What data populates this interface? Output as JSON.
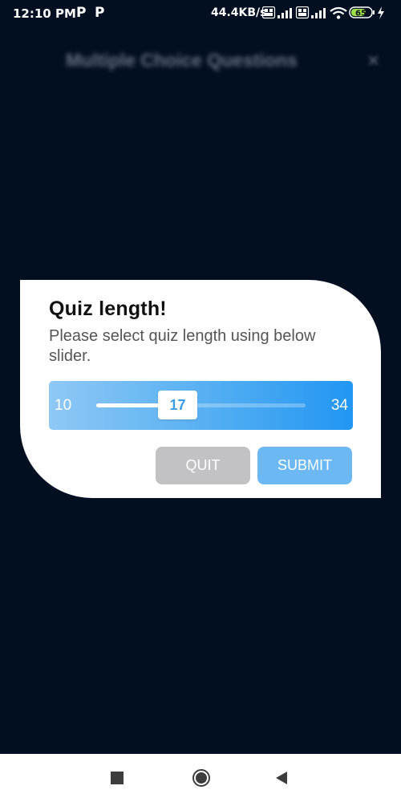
{
  "status_bar": {
    "time": "12:10 PM",
    "notif_1": "P",
    "notif_2": "P",
    "net_speed": "44.4KB/s",
    "volte_1": "Vo LTE",
    "volte_2": "Vo LTE",
    "battery": "65",
    "icons": [
      "signal-icon",
      "signal-icon",
      "wifi-icon",
      "battery-icon",
      "charging-icon"
    ]
  },
  "background": {
    "title": "Multiple Choice Questions",
    "close": "×"
  },
  "dialog": {
    "title": "Quiz length!",
    "message": "Please select quiz length using below slider.",
    "slider": {
      "min": "10",
      "max": "34",
      "value": "17",
      "min_value": 10,
      "max_value": 34,
      "current_value": 17
    },
    "quit_label": "QUIT",
    "submit_label": "SUBMIT"
  },
  "colors": {
    "background": "#020f21",
    "slider_start": "#8fc8f6",
    "slider_end": "#2196f3",
    "submit": "#6bb8f5",
    "quit": "#c2c2c4"
  },
  "nav_bar": {
    "icons": [
      "recent-apps-icon",
      "home-icon",
      "back-icon"
    ]
  }
}
